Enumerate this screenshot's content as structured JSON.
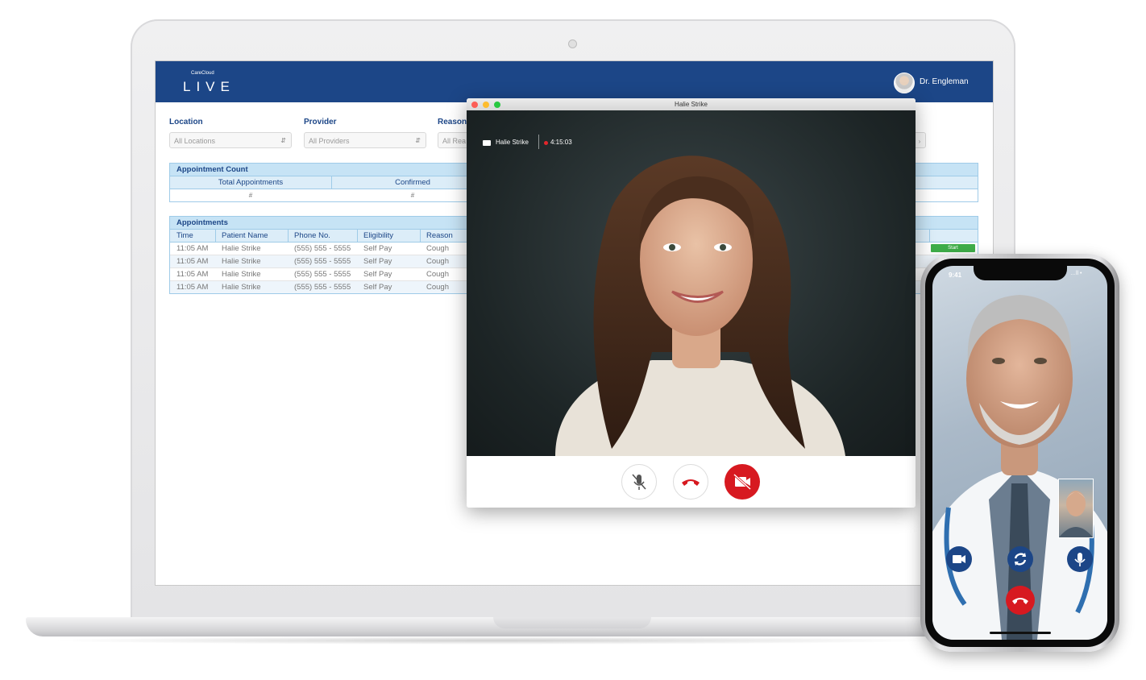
{
  "app": {
    "brand_small": "CareCloud",
    "brand_name": "LIVE",
    "user_name": "Dr. Engleman"
  },
  "filters": [
    {
      "label": "Location",
      "value": "All Locations"
    },
    {
      "label": "Provider",
      "value": "All Providers"
    },
    {
      "label": "Reason",
      "value": "All Rea"
    }
  ],
  "appointment_count": {
    "caption": "Appointment Count",
    "headers": [
      "Total Appointments",
      "Confirmed"
    ],
    "values": [
      "#",
      "#"
    ]
  },
  "appointments": {
    "caption": "Appointments",
    "headers": [
      "Time",
      "Patient Name",
      "Phone No.",
      "Eligibility",
      "Reason"
    ],
    "rows": [
      [
        "11:05 AM",
        "Halie Strike",
        "(555) 555 - 5555",
        "Self Pay",
        "Cough"
      ],
      [
        "11:05 AM",
        "Halie Strike",
        "(555) 555 - 5555",
        "Self Pay",
        "Cough"
      ],
      [
        "11:05 AM",
        "Halie Strike",
        "(555) 555 - 5555",
        "Self Pay",
        "Cough"
      ],
      [
        "11:05 AM",
        "Halie Strike",
        "(555) 555 - 5555",
        "Self Pay",
        "Cough"
      ]
    ],
    "start_label": "Start"
  },
  "video_call": {
    "window_title": "Halie Strike",
    "caller_name": "Halie Strike",
    "elapsed": "4:15:03",
    "controls": [
      "mic-muted-icon",
      "end-call-icon",
      "camera-off-icon"
    ]
  },
  "phone": {
    "time": "9:41",
    "status": "…ll •"
  },
  "colors": {
    "brand_blue": "#1c4687",
    "table_header": "#c6e3f5",
    "start_green": "#3fae49",
    "end_call_red": "#d71920"
  }
}
